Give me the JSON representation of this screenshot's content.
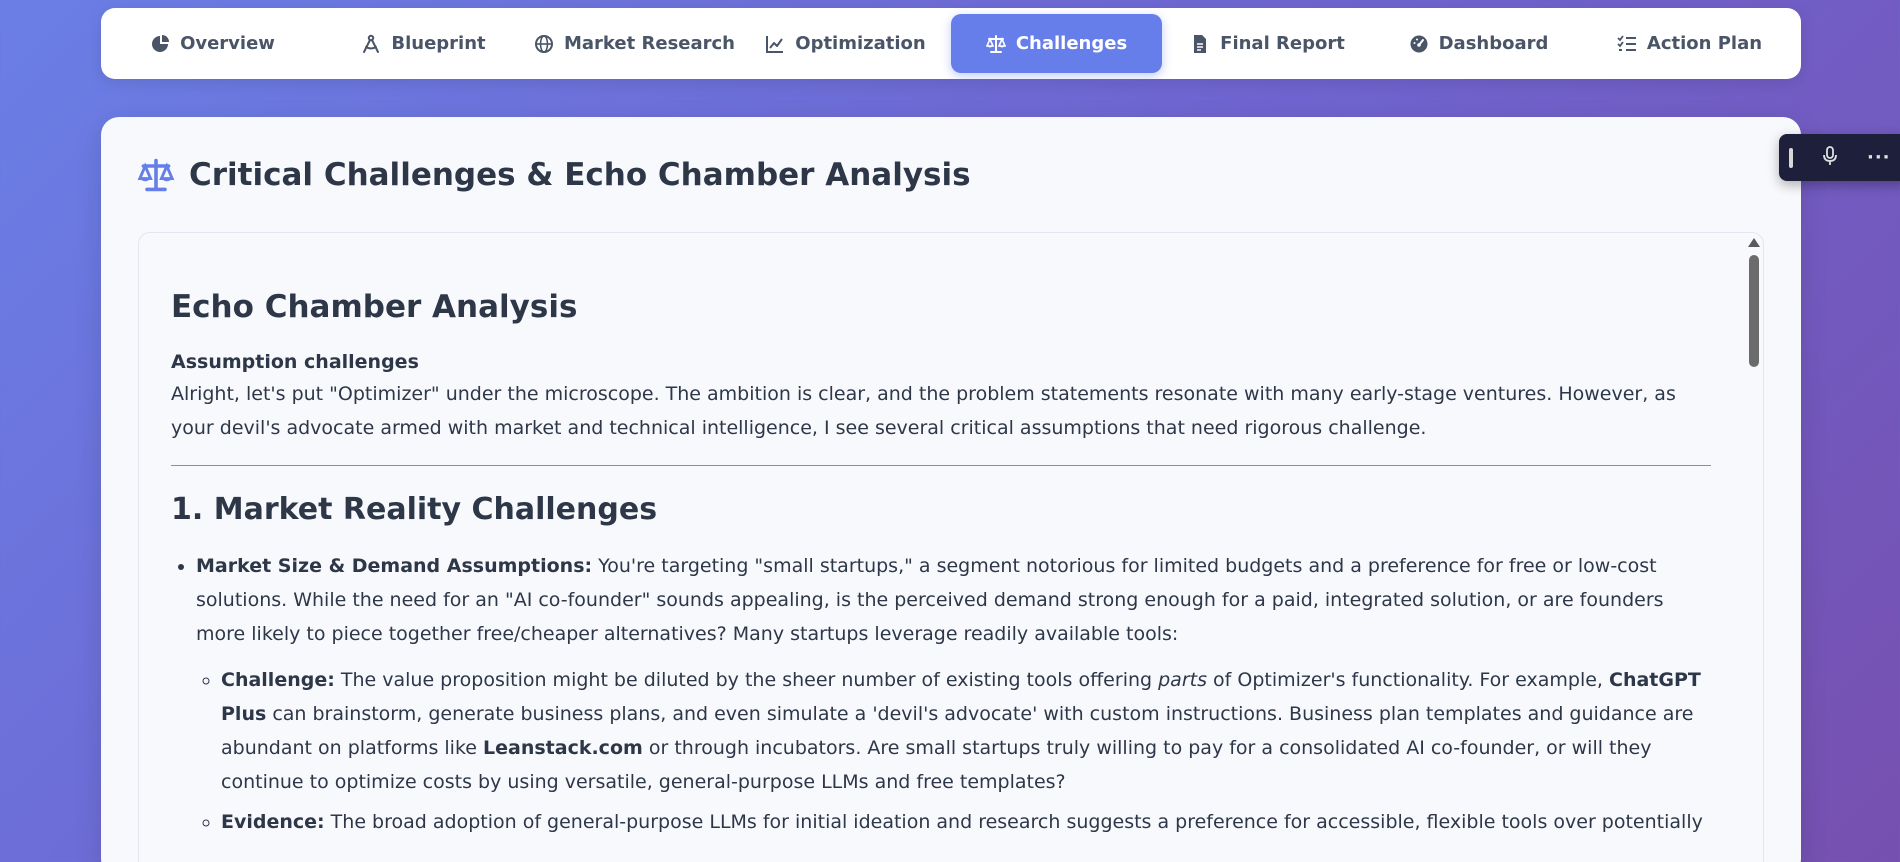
{
  "tabs": [
    {
      "label": "Overview",
      "icon": "pie-chart-icon"
    },
    {
      "label": "Blueprint",
      "icon": "compass-drafting-icon"
    },
    {
      "label": "Market Research",
      "icon": "globe-icon"
    },
    {
      "label": "Optimization",
      "icon": "line-chart-icon"
    },
    {
      "label": "Challenges",
      "icon": "balance-scale-icon",
      "active": true
    },
    {
      "label": "Final Report",
      "icon": "file-icon"
    },
    {
      "label": "Dashboard",
      "icon": "gauge-icon"
    },
    {
      "label": "Action Plan",
      "icon": "checklist-icon"
    }
  ],
  "page": {
    "title": "Critical Challenges & Echo Chamber Analysis",
    "icon": "balance-scale-icon"
  },
  "content": {
    "heading": "Echo Chamber Analysis",
    "subheading": "Assumption challenges",
    "intro": "Alright, let's put \"Optimizer\" under the microscope. The ambition is clear, and the problem statements resonate with many early-stage ventures. However, as your devil's advocate armed with market and technical intelligence, I see several critical assumptions that need rigorous challenge.",
    "section1_title": "1. Market Reality Challenges",
    "item1_label": "Market Size & Demand Assumptions:",
    "item1_text": " You're targeting \"small startups,\" a segment notorious for limited budgets and a preference for free or low-cost solutions. While the need for an \"AI co-founder\" sounds appealing, is the perceived demand strong enough for a paid, integrated solution, or are founders more likely to piece together free/cheaper alternatives? Many startups leverage readily available tools:",
    "challenge_label": "Challenge:",
    "challenge_t1": " The value proposition might be diluted by the sheer number of existing tools offering ",
    "challenge_em": "parts",
    "challenge_t2": " of Optimizer's functionality. For example, ",
    "challenge_b1": "ChatGPT Plus",
    "challenge_t3": " can brainstorm, generate business plans, and even simulate a 'devil's advocate' with custom instructions. Business plan templates and guidance are abundant on platforms like ",
    "challenge_b2": "Leanstack.com",
    "challenge_t4": " or through incubators. Are small startups truly willing to pay for a consolidated AI co-founder, or will they continue to optimize costs by using versatile, general-purpose LLMs and free templates?",
    "evidence_label": "Evidence:",
    "evidence_text": " The broad adoption of general-purpose LLMs for initial ideation and research suggests a preference for accessible, flexible tools over potentially"
  },
  "floatbar": {
    "mic_icon": "microphone-icon",
    "more_label": "···"
  },
  "colors": {
    "accent": "#667eea",
    "text": "#2d3748"
  }
}
